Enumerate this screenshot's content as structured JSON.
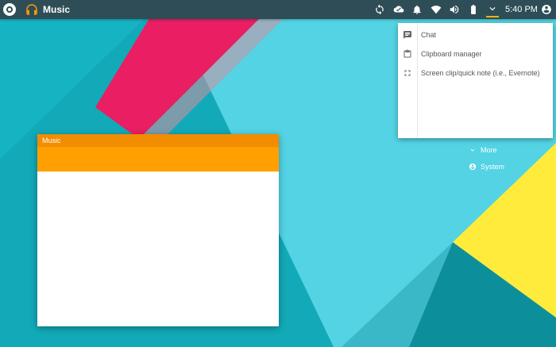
{
  "topbar": {
    "app_title": "Music",
    "clock": "5:40 PM",
    "icons": [
      "launcher-icon",
      "headphones-icon",
      "sync-icon",
      "cloud-icon",
      "bell-icon",
      "wifi-icon",
      "volume-icon",
      "battery-icon",
      "chevron-down-icon",
      "account-icon"
    ]
  },
  "dropdown": {
    "items": [
      {
        "label": "Chat",
        "icon": "chat-icon"
      },
      {
        "label": "Clipboard manager",
        "icon": "clipboard-icon"
      },
      {
        "label": "Screen clip/quick note (i.e., Evernote)",
        "icon": "fullscreen-icon"
      }
    ]
  },
  "desktop": {
    "more_label": "More",
    "system_label": "System"
  },
  "window": {
    "title": "Music"
  },
  "colors": {
    "topbar": "#2e4d57",
    "window_title": "#f28c00",
    "window_toolbar": "#ffa000",
    "accent_indicator": "#ffb300"
  }
}
